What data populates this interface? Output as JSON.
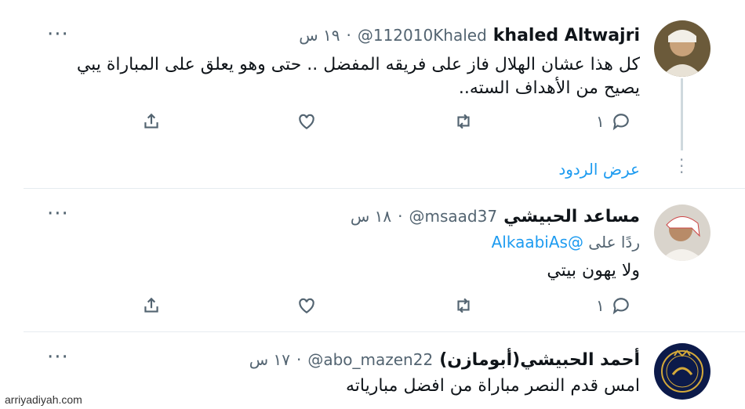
{
  "tweets": [
    {
      "name": "khaled Altwajri",
      "handle": "@112010Khaled",
      "time": "١٩ س",
      "text_line1": "كل هذا عشان الهلال فاز على فريقه المفضل .. حتى وهو يعلق على المباراة يبي",
      "text_line2": "يصيح من الأهداف السته..",
      "reply_count": "١",
      "show_replies": "عرض الردود"
    },
    {
      "name": "مساعد الحبيشي",
      "handle": "@msaad37",
      "time": "١٨ س",
      "reply_prefix": "ردًا على",
      "reply_mention": "@AlkaabiAs",
      "text": "ولا يهون بيتي",
      "reply_count": "١"
    },
    {
      "name": "أحمد الحبيشي(أبومازن)",
      "handle": "@abo_mazen22",
      "time": "١٧ س",
      "text": "امس قدم النصر مباراة من افضل مبارياته"
    }
  ],
  "separator": "·",
  "more_label": "···",
  "watermark": "arriyadiyah.com",
  "icons": [
    "more-icon",
    "reply-icon",
    "retweet-icon",
    "like-icon",
    "share-icon"
  ],
  "colors": {
    "link": "#1d9bf0",
    "muted": "#536471",
    "text": "#0f1419"
  }
}
